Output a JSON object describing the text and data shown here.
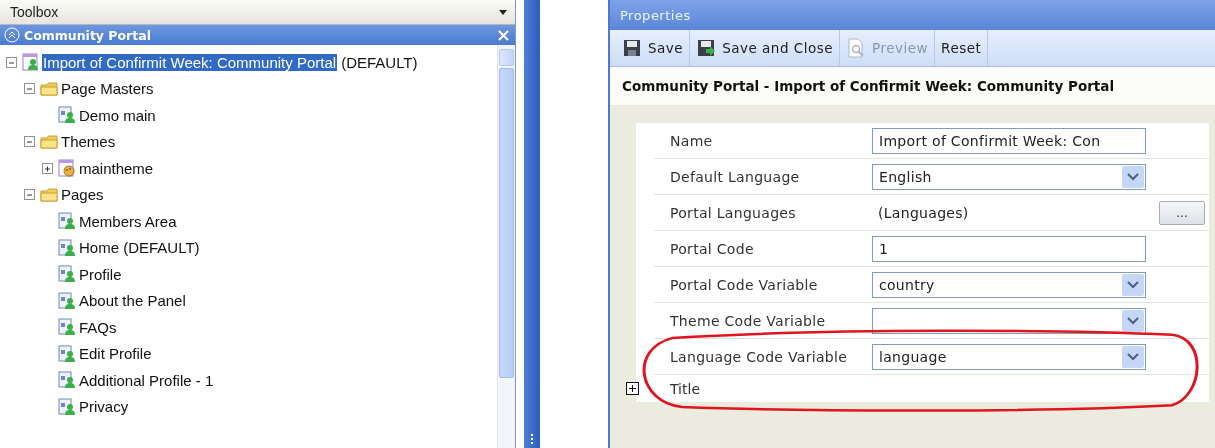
{
  "toolbox": {
    "title": "Toolbox"
  },
  "section": {
    "title": "Community Portal"
  },
  "tree": [
    {
      "kind": "portal",
      "label": "Import of Confirmit Week: Community Portal",
      "suffix": "(DEFAULT)",
      "selected": true,
      "expanded": true,
      "children": [
        {
          "kind": "folder",
          "label": "Page Masters",
          "selected": false,
          "expanded": true,
          "children": [
            {
              "kind": "page",
              "label": "Demo main",
              "selected": false
            }
          ]
        },
        {
          "kind": "folder",
          "label": "Themes",
          "selected": false,
          "expanded": true,
          "children": [
            {
              "kind": "theme",
              "label": "maintheme",
              "selected": false,
              "expanded": false
            }
          ]
        },
        {
          "kind": "folder",
          "label": "Pages",
          "selected": false,
          "expanded": true,
          "children": [
            {
              "kind": "page",
              "label": "Members Area",
              "selected": false
            },
            {
              "kind": "page",
              "label": "Home (DEFAULT)",
              "selected": false
            },
            {
              "kind": "page",
              "label": "Profile",
              "selected": false
            },
            {
              "kind": "page",
              "label": "About the Panel",
              "selected": false
            },
            {
              "kind": "page",
              "label": "FAQs",
              "selected": false
            },
            {
              "kind": "page",
              "label": "Edit Profile",
              "selected": false
            },
            {
              "kind": "page",
              "label": "Additional Profile - 1",
              "selected": false
            },
            {
              "kind": "page",
              "label": "Privacy",
              "selected": false
            }
          ]
        }
      ]
    }
  ],
  "properties": {
    "title": "Properties",
    "toolbar": [
      {
        "kind": "save",
        "label": "Save",
        "disabled": false
      },
      {
        "kind": "save-close",
        "label": "Save and Close",
        "disabled": false
      },
      {
        "kind": "preview",
        "label": "Preview",
        "disabled": true
      },
      {
        "kind": "plain",
        "label": "Reset",
        "disabled": false
      }
    ],
    "heading": "Community Portal - Import of Confirmit Week: Community Portal",
    "rows": [
      {
        "kind": "text",
        "label": "Name",
        "value": "Import of Confirmit Week: Con"
      },
      {
        "kind": "select",
        "label": "Default Language",
        "value": "English"
      },
      {
        "kind": "collection",
        "label": "Portal Languages",
        "value": "(Languages)",
        "button": "..."
      },
      {
        "kind": "text",
        "label": "Portal Code",
        "value": "1"
      },
      {
        "kind": "select",
        "label": "Portal Code Variable",
        "value": "country"
      },
      {
        "kind": "select",
        "label": "Theme Code Variable"
      },
      {
        "kind": "select",
        "label": "Language Code Variable",
        "value": "language"
      },
      {
        "kind": "group",
        "label": "Title",
        "expanded": false
      }
    ]
  }
}
